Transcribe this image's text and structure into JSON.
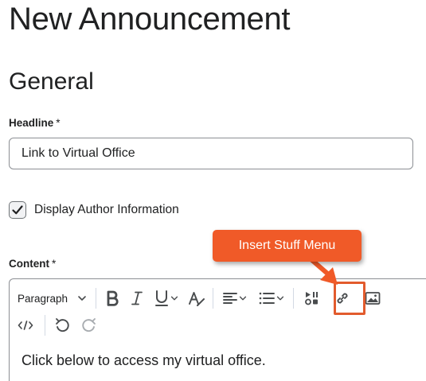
{
  "page": {
    "title": "New Announcement",
    "section_title": "General"
  },
  "headline": {
    "label": "Headline",
    "required_mark": "*",
    "value": "Link to Virtual Office"
  },
  "author_info": {
    "label": "Display Author Information",
    "checked": true
  },
  "content": {
    "label": "Content",
    "required_mark": "*",
    "body_text": "Click below to access my virtual office."
  },
  "toolbar": {
    "format_select_value": "Paragraph",
    "row1_icons": [
      "bold-icon",
      "italic-icon",
      "underline-icon",
      "text-style-icon",
      "align-icon",
      "list-icon",
      "insert-stuff-icon",
      "link-icon",
      "image-icon"
    ],
    "row2_icons": [
      "source-code-icon",
      "undo-icon",
      "redo-icon"
    ]
  },
  "annotation": {
    "callout_text": "Insert Stuff Menu",
    "color": "#f05a28"
  },
  "colors": {
    "text": "#202122",
    "icon": "#494c4e",
    "border": "#8c8f94",
    "annotation": "#f05a28"
  }
}
